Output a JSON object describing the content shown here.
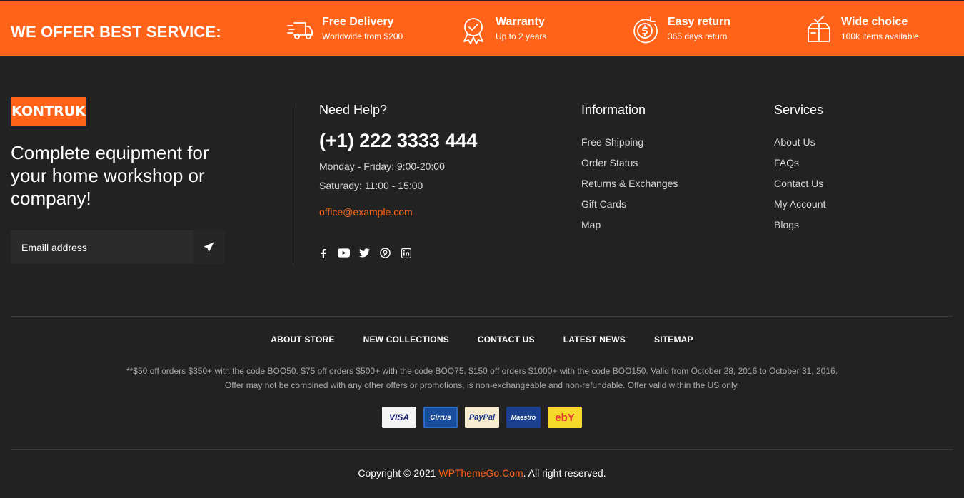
{
  "service_bar": {
    "title": "WE OFFER BEST SERVICE:",
    "items": [
      {
        "title": "Free Delivery",
        "subtitle": "Worldwide from $200",
        "icon": "truck-icon"
      },
      {
        "title": "Warranty",
        "subtitle": "Up to 2 years",
        "icon": "award-icon"
      },
      {
        "title": "Easy return",
        "subtitle": "365 days return",
        "icon": "dollar-return-icon"
      },
      {
        "title": "Wide choice",
        "subtitle": "100k items available",
        "icon": "box-icon"
      }
    ]
  },
  "brand": {
    "logo": "KONTRUK",
    "tagline": "Complete equipment for your home workshop or company!",
    "email_placeholder": "Emaill address"
  },
  "help": {
    "title": "Need Help?",
    "phone": "(+1) 222 3333 444",
    "hours_weekday": "Monday - Friday: 9:00-20:00",
    "hours_saturday": "Saturady: 11:00 - 15:00",
    "email": "office@example.com",
    "socials": [
      "facebook-icon",
      "youtube-icon",
      "twitter-icon",
      "pinterest-icon",
      "linkedin-icon"
    ]
  },
  "information": {
    "title": "Information",
    "links": [
      "Free Shipping",
      "Order Status",
      "Returns & Exchanges",
      "Gift Cards",
      "Map"
    ]
  },
  "services": {
    "title": "Services",
    "links": [
      "About Us",
      "FAQs",
      "Contact Us",
      "My Account",
      "Blogs"
    ]
  },
  "bottom_nav": [
    "ABOUT STORE",
    "NEW COLLECTIONS",
    "CONTACT US",
    "LATEST NEWS",
    "SITEMAP"
  ],
  "disclaimer": "**$50 off orders $350+ with the code BOO50. $75 off orders $500+ with the code BOO75. $150 off orders $1000+ with the code BOO150. Valid from October 28, 2016 to October 31, 2016. Offer may not be combined with any other offers or promotions, is non-exchangeable and non-refundable. Offer valid within the US only.",
  "payments": [
    {
      "label": "VISA",
      "icon": "visa-icon"
    },
    {
      "label": "Cirrus",
      "icon": "cirrus-icon"
    },
    {
      "label": "PayPal",
      "icon": "paypal-icon"
    },
    {
      "label": "Maestro",
      "icon": "maestro-icon"
    },
    {
      "label": "ebY",
      "icon": "ebay-icon"
    }
  ],
  "copyright": {
    "prefix": "Copyright © 2021 ",
    "brand": "WPThemeGo.Com",
    "suffix": ". All right reserved."
  },
  "colors": {
    "accent": "#ff6319",
    "background": "#222222"
  }
}
